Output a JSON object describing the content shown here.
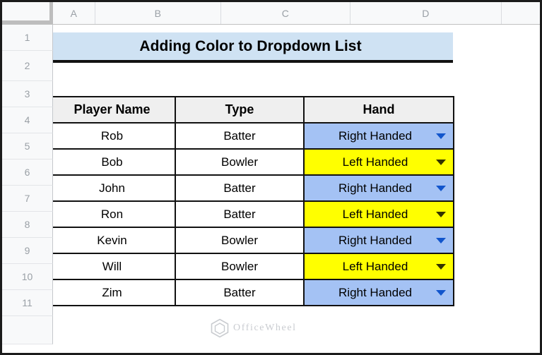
{
  "app": {
    "type": "spreadsheet",
    "colors": {
      "title_bg": "#cfe2f3",
      "header_bg": "#efefef",
      "right_handed_bg": "#a4c2f4",
      "left_handed_bg": "#ffff00",
      "arrow_blue": "#1155cc",
      "arrow_yellow": "#333300",
      "grid_line": "#111111",
      "sheet_chrome": "#f8f9fa"
    }
  },
  "grid": {
    "column_headers": [
      "A",
      "B",
      "C",
      "D",
      ""
    ],
    "row_headers": [
      "1",
      "2",
      "3",
      "4",
      "5",
      "6",
      "7",
      "8",
      "9",
      "10",
      "11"
    ]
  },
  "title": {
    "text": "Adding Color to Dropdown List"
  },
  "table": {
    "headers": [
      "Player Name",
      "Type",
      "Hand"
    ],
    "rows": [
      {
        "player_name": "Rob",
        "type": "Batter",
        "hand": "Right Handed",
        "hand_style": "blue"
      },
      {
        "player_name": "Bob",
        "type": "Bowler",
        "hand": "Left Handed",
        "hand_style": "yellow"
      },
      {
        "player_name": "John",
        "type": "Batter",
        "hand": "Right Handed",
        "hand_style": "blue"
      },
      {
        "player_name": "Ron",
        "type": "Batter",
        "hand": "Left Handed",
        "hand_style": "yellow"
      },
      {
        "player_name": "Kevin",
        "type": "Bowler",
        "hand": "Right Handed",
        "hand_style": "blue"
      },
      {
        "player_name": "Will",
        "type": "Bowler",
        "hand": "Left Handed",
        "hand_style": "yellow"
      },
      {
        "player_name": "Zim",
        "type": "Batter",
        "hand": "Right Handed",
        "hand_style": "blue"
      }
    ]
  },
  "watermark": {
    "text": "OfficeWheel",
    "logo_icon": "hexagon-logo-icon"
  }
}
